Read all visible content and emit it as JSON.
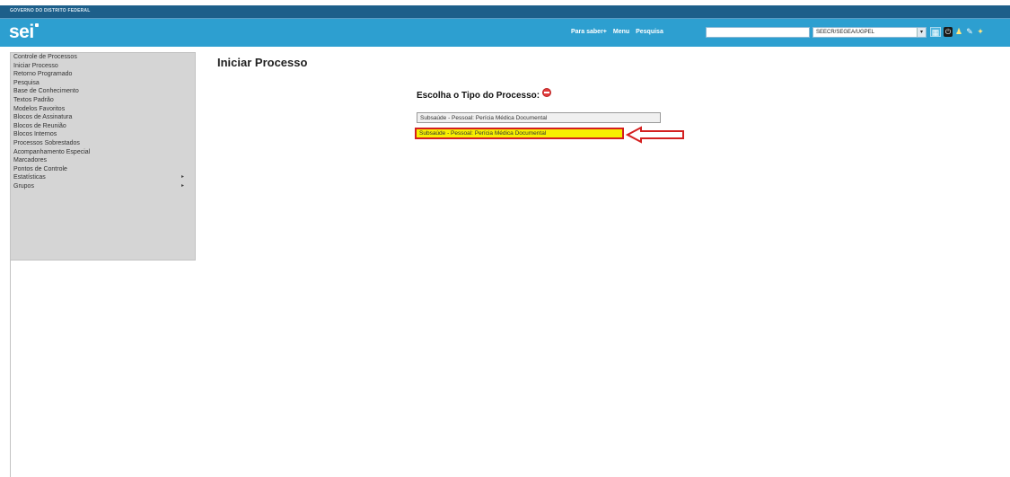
{
  "topbar": {
    "gov_label": "GOVERNO DO DISTRITO FEDERAL"
  },
  "header": {
    "logo": "sei",
    "links": [
      "Para saber+",
      "Menu",
      "Pesquisa"
    ],
    "search_value": "",
    "unit_value": "SEECR/SEGEA/UGPEL",
    "icons": [
      "grid-icon",
      "exit-icon",
      "user-icon",
      "pencil-icon",
      "star-icon"
    ]
  },
  "sidebar": {
    "items": [
      {
        "label": "Controle de Processos",
        "submenu": false
      },
      {
        "label": "Iniciar Processo",
        "submenu": false
      },
      {
        "label": "Retorno Programado",
        "submenu": false
      },
      {
        "label": "Pesquisa",
        "submenu": false
      },
      {
        "label": "Base de Conhecimento",
        "submenu": false
      },
      {
        "label": "Textos Padrão",
        "submenu": false
      },
      {
        "label": "Modelos Favoritos",
        "submenu": false
      },
      {
        "label": "Blocos de Assinatura",
        "submenu": false
      },
      {
        "label": "Blocos de Reunião",
        "submenu": false
      },
      {
        "label": "Blocos Internos",
        "submenu": false
      },
      {
        "label": "Processos Sobrestados",
        "submenu": false
      },
      {
        "label": "Acompanhamento Especial",
        "submenu": false
      },
      {
        "label": "Marcadores",
        "submenu": false
      },
      {
        "label": "Pontos de Controle",
        "submenu": false
      },
      {
        "label": "Estatísticas",
        "submenu": true
      },
      {
        "label": "Grupos",
        "submenu": true
      }
    ],
    "submenu_arrow": "▸"
  },
  "main": {
    "title": "Iniciar Processo",
    "choose_label": "Escolha o Tipo do Processo:",
    "tipo_input_value": "Subsaúde - Pessoal: Perícia Médica Documental",
    "suggestion": "Subsaúde - Pessoal: Perícia Médica Documental"
  },
  "colors": {
    "header_bg": "#2d9fd0",
    "topbar_bg": "#1d5f8a",
    "highlight_bg": "#f7ef00",
    "highlight_border": "#d42020"
  }
}
